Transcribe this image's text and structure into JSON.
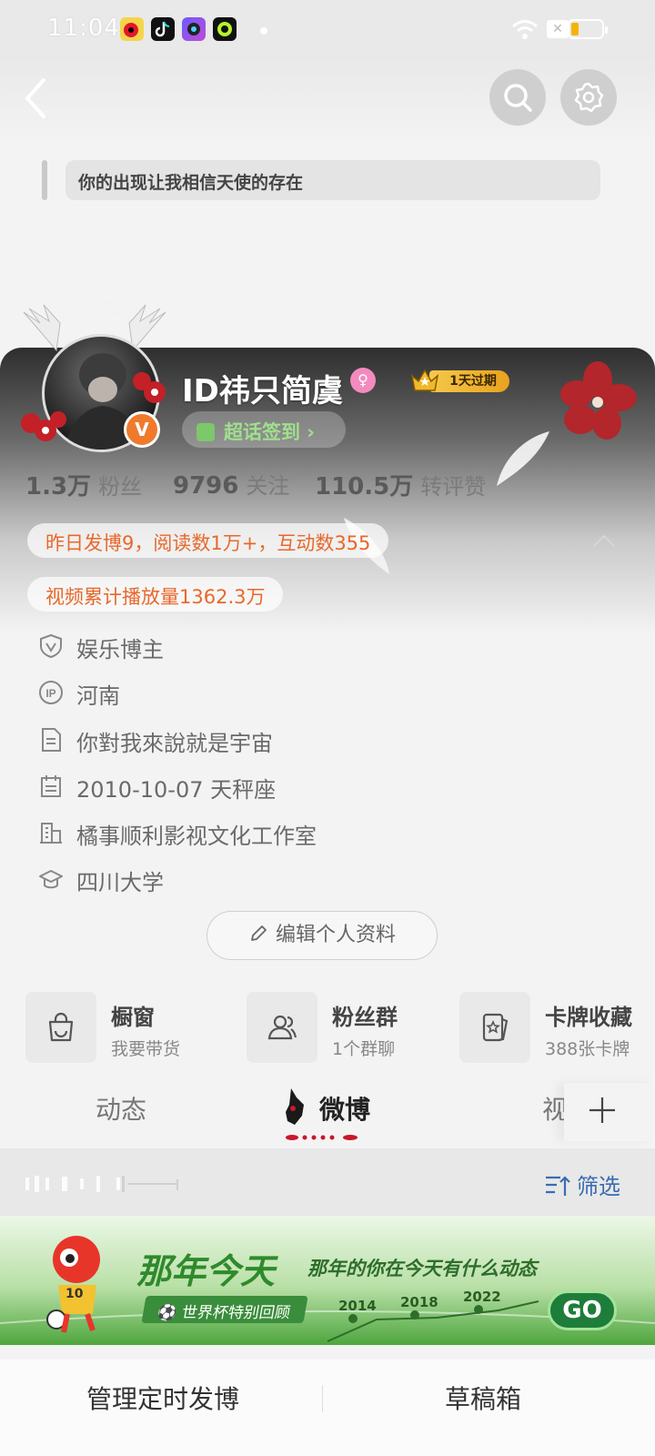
{
  "status_bar": {
    "time": "11:04",
    "app_icons": [
      "weibo-icon",
      "tiktok-icon",
      "camera-app-icon",
      "green-app-icon"
    ],
    "battery_color": "#f5b400"
  },
  "header": {
    "back_icon": "chevron-left-icon",
    "search_icon": "search-icon",
    "settings_icon": "gear-icon"
  },
  "profile": {
    "signature": "你的出现让我相信天使的存在",
    "username": "ID祎只简虞",
    "gender_icon": "female-icon",
    "verified_badge": "V",
    "vip_label": "1天过期",
    "supertopic_checkin": "超话签到 ›",
    "stats": [
      {
        "value": "1.3万",
        "label": "粉丝"
      },
      {
        "value": "9796",
        "label": "关注"
      },
      {
        "value": "110.5万",
        "label": "转评赞"
      }
    ],
    "yesterday_summary": "昨日发博9，阅读数1万+，互动数355",
    "video_plays": "视频累计播放量1362.3万",
    "info": [
      {
        "icon": "shield-v-icon",
        "text": "娱乐博主"
      },
      {
        "icon": "ip-icon",
        "text": "河南"
      },
      {
        "icon": "document-icon",
        "text": "你對我來說就是宇宙"
      },
      {
        "icon": "calendar-icon",
        "text": "2010-10-07 天秤座"
      },
      {
        "icon": "building-icon",
        "text": "橘事顺利影视文化工作室"
      },
      {
        "icon": "graduation-cap-icon",
        "text": "四川大学"
      }
    ],
    "edit_button": "编辑个人资料"
  },
  "tools": [
    {
      "icon": "shopping-bag-icon",
      "title": "橱窗",
      "subtitle": "我要带货"
    },
    {
      "icon": "fan-group-icon",
      "title": "粉丝群",
      "subtitle": "1个群聊"
    },
    {
      "icon": "card-icon",
      "title": "卡牌收藏",
      "subtitle": "388张卡牌"
    }
  ],
  "tabs": {
    "items": [
      "动态",
      "微博",
      "视"
    ],
    "active": "微博",
    "add_icon": "plus-icon"
  },
  "filter": {
    "label": "筛选",
    "icon": "filter-icon"
  },
  "banner": {
    "title": "那年今天",
    "subtitle": "那年的你在今天有什么动态",
    "tag": "世界杯特别回顾",
    "years": [
      "2014",
      "2018",
      "2022"
    ],
    "go": "GO",
    "mascot_number": "10"
  },
  "bottom_bar": {
    "scheduled": "管理定时发博",
    "drafts": "草稿箱"
  }
}
